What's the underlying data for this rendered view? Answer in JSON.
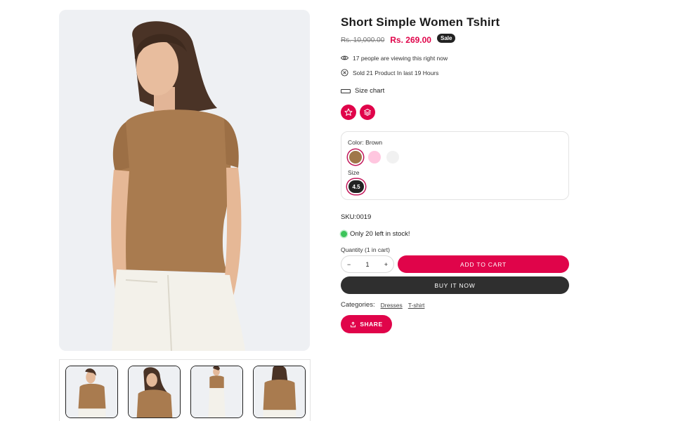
{
  "product": {
    "title": "Short Simple Women Tshirt",
    "old_price": "Rs. 10,000.00",
    "price": "Rs. 269.00",
    "sale_badge": "Sale",
    "viewing_text": "17 people are viewing this right now",
    "sold_text": "Sold 21 Product In last 19 Hours",
    "size_chart_label": "Size chart",
    "sku": "SKU:0019",
    "stock_text": "Only 20 left in stock!",
    "quantity_label": "Quantity (1 in cart)",
    "quantity_value": "1",
    "qty_minus": "−",
    "qty_plus": "+",
    "add_to_cart_label": "ADD TO CART",
    "buy_now_label": "BUY IT NOW",
    "categories_label": "Categories:",
    "categories": [
      "Dresses",
      "T-shirt"
    ],
    "share_label": "SHARE"
  },
  "variants": {
    "color_label": "Color:",
    "color_value": "Brown",
    "colors": [
      "#a0774a",
      "#ffc6df",
      "#f1f1f1"
    ],
    "size_label": "Size",
    "sizes": [
      "4.5"
    ]
  },
  "icons": {
    "wishlist": "star-icon",
    "compare": "layers-icon",
    "viewing": "eye-icon",
    "sold": "clock-icon",
    "size_chart": "ruler-icon",
    "share": "upload-icon"
  },
  "theme": {
    "accent": "#e0044a",
    "dark": "#2f2f2f",
    "stock_green": "#3cc45a",
    "shirt": "#a97b4f",
    "pants": "#f3f1ea"
  }
}
